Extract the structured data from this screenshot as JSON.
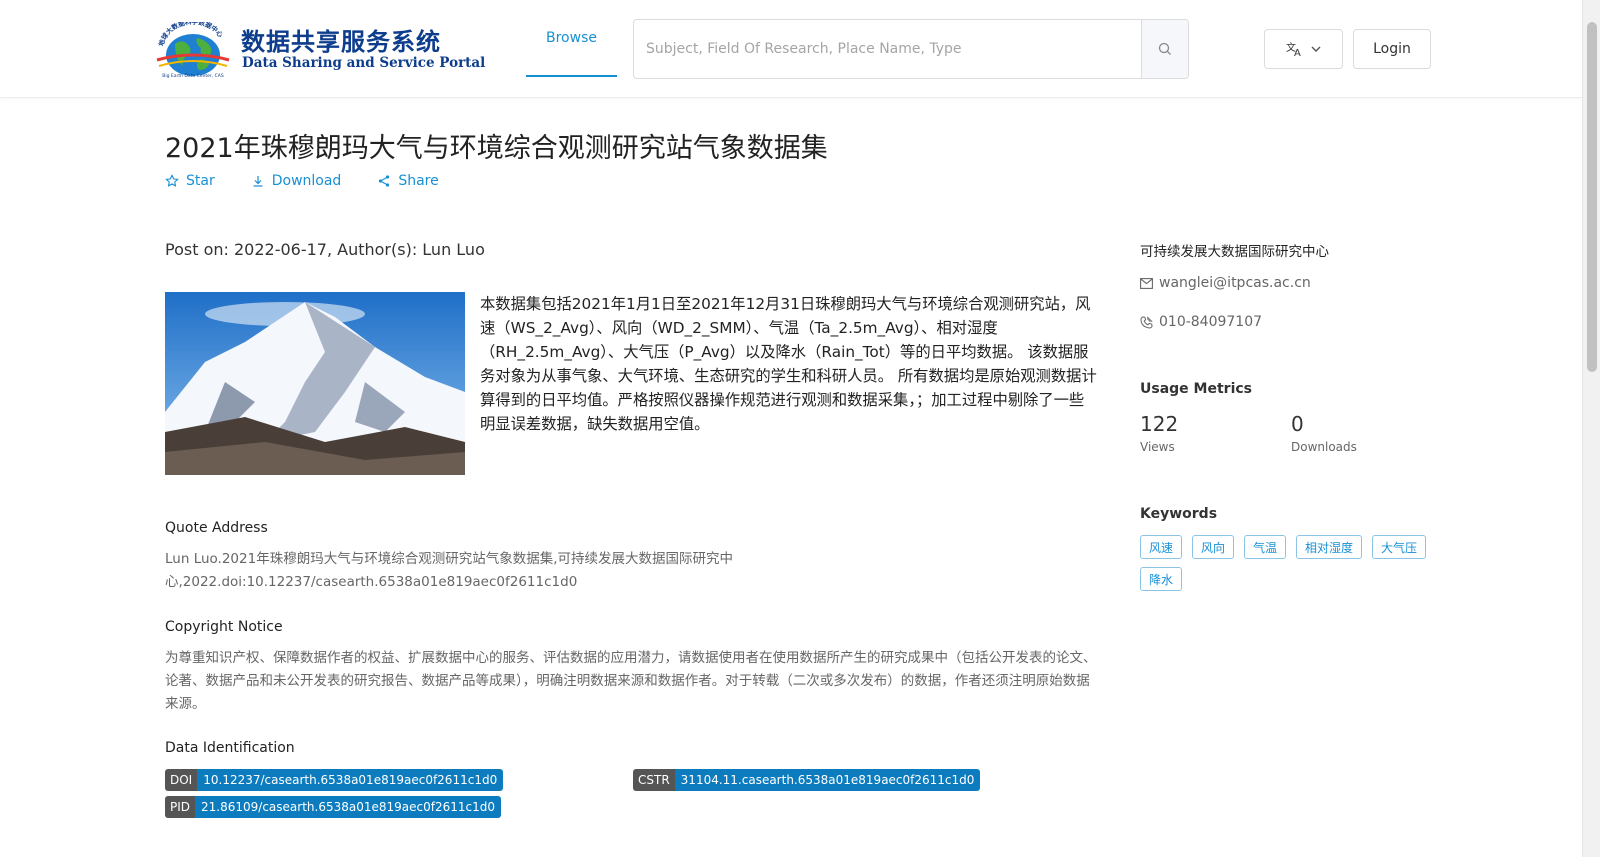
{
  "header": {
    "logo": {
      "cn_text": "数据共享服务系统",
      "en_text": "Data Sharing and Service Portal",
      "seal_text": "地球大数据科学数据中心",
      "seal_en": "Big Earth Data Center, CAS"
    },
    "nav": {
      "browse_label": "Browse"
    },
    "search": {
      "placeholder": "Subject, Field Of Research, Place Name, Type"
    },
    "login_label": "Login",
    "language_icon": "translate-icon"
  },
  "dataset": {
    "title": "2021年珠穆朗玛大气与环境综合观测研究站气象数据集",
    "actions": {
      "star": "Star",
      "download": "Download",
      "share": "Share"
    },
    "post_info": "Post on: 2022-06-17, Author(s): Lun Luo",
    "description": "本数据集包括2021年1月1日至2021年12月31日珠穆朗玛大气与环境综合观测研究站，风速（WS_2_Avg）、风向（WD_2_SMM）、气温（Ta_2.5m_Avg）、相对湿度（RH_2.5m_Avg）、大气压（P_Avg）以及降水（Rain_Tot）等的日平均数据。 该数据服务对象为从事气象、大气环境、生态研究的学生和科研人员。 所有数据均是原始观测数据计算得到的日平均值。严格按照仪器操作规范进行观测和数据采集，；加工过程中剔除了一些明显误差数据，缺失数据用空值。",
    "quote": {
      "title": "Quote Address",
      "text": "Lun Luo.2021年珠穆朗玛大气与环境综合观测研究站气象数据集,可持续发展大数据国际研究中心,2022.doi:10.12237/casearth.6538a01e819aec0f2611c1d0"
    },
    "copyright": {
      "title": "Copyright Notice",
      "text": "为尊重知识产权、保障数据作者的权益、扩展数据中心的服务、评估数据的应用潜力，请数据使用者在使用数据所产生的研究成果中（包括公开发表的论文、论著、数据产品和未公开发表的研究报告、数据产品等成果），明确注明数据来源和数据作者。对于转载（二次或多次发布）的数据，作者还须注明原始数据来源。"
    },
    "identification": {
      "title": "Data Identification",
      "doi": {
        "key": "DOI",
        "value": "10.12237/casearth.6538a01e819aec0f2611c1d0"
      },
      "cstr": {
        "key": "CSTR",
        "value": "31104.11.casearth.6538a01e819aec0f2611c1d0"
      },
      "pid": {
        "key": "PID",
        "value": "21.86109/casearth.6538a01e819aec0f2611c1d0"
      }
    }
  },
  "sidebar": {
    "organization": "可持续发展大数据国际研究中心",
    "email": "wanglei@itpcas.ac.cn",
    "phone": "010-84097107",
    "usage": {
      "title": "Usage Metrics",
      "views": "122",
      "views_label": "Views",
      "downloads": "0",
      "downloads_label": "Downloads"
    },
    "keywords": {
      "title": "Keywords",
      "items": [
        "风速",
        "风向",
        "气温",
        "相对湿度",
        "大气压",
        "降水"
      ]
    }
  },
  "colors": {
    "accent": "#1890d5",
    "badge_value": "#0c7cbf",
    "badge_key": "#555555",
    "logo_text": "#0d3d8c"
  }
}
